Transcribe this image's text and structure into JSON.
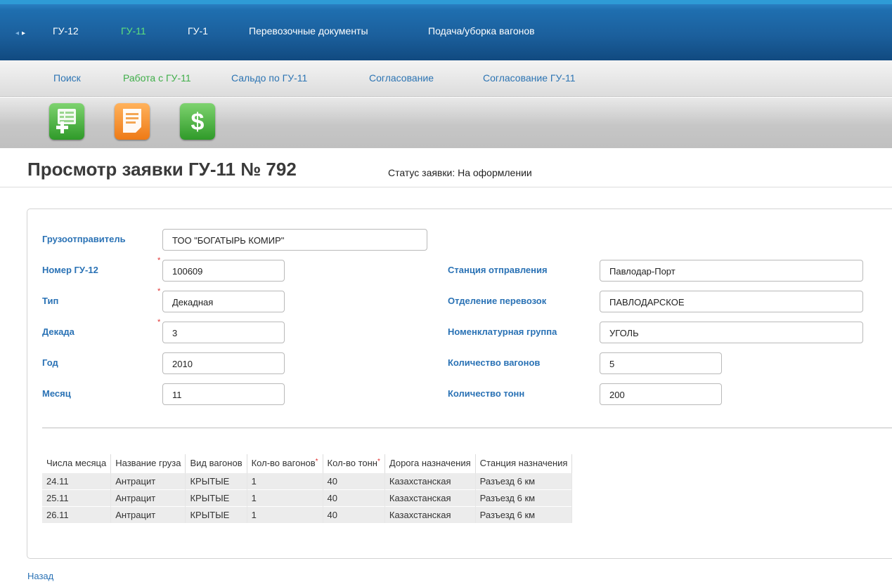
{
  "topnav": {
    "items": [
      {
        "label": "ГУ-12"
      },
      {
        "label": "ГУ-11"
      },
      {
        "label": "ГУ-1"
      },
      {
        "label": "Перевозочные документы"
      },
      {
        "label": "Подача/уборка вагонов"
      }
    ],
    "active_index": 1
  },
  "subnav": {
    "items": [
      {
        "label": "Поиск"
      },
      {
        "label": "Работа с ГУ-11"
      },
      {
        "label": "Сальдо по ГУ-11"
      },
      {
        "label": "Согласование"
      },
      {
        "label": "Согласование ГУ-11"
      }
    ],
    "active_index": 1
  },
  "toolbar": {
    "buttons": [
      {
        "icon": "add-document-icon",
        "color": "#3fa83a"
      },
      {
        "icon": "document-icon",
        "color": "#f08a22"
      },
      {
        "icon": "dollar-icon",
        "color": "#3fa83a"
      }
    ]
  },
  "page": {
    "title": "Просмотр заявки ГУ-11 №  792",
    "status": "Статус заявки: На оформлении"
  },
  "form": {
    "shipper": {
      "label": "Грузоотправитель",
      "value": "ТОО \"БОГАТЫРЬ КОМИР\""
    },
    "gu12_number": {
      "label": "Номер ГУ-12",
      "value": "100609",
      "required": true
    },
    "type": {
      "label": "Тип",
      "value": "Декадная",
      "required": true
    },
    "decade": {
      "label": "Декада",
      "value": "3",
      "required": true
    },
    "year": {
      "label": "Год",
      "value": "2010"
    },
    "month": {
      "label": "Месяц",
      "value": "11"
    },
    "departure_station": {
      "label": "Станция отправления",
      "value": "Павлодар-Порт"
    },
    "transport_division": {
      "label": "Отделение перевозок",
      "value": "ПАВЛОДАРСКОЕ"
    },
    "nomenclature_group": {
      "label": "Номенклатурная группа",
      "value": "УГОЛЬ"
    },
    "wagon_count": {
      "label": "Количество вагонов",
      "value": "5"
    },
    "tonnage": {
      "label": "Количество тонн",
      "value": "200"
    },
    "required_mark": "*"
  },
  "table": {
    "headers": [
      {
        "label": "Числа месяца",
        "required": false
      },
      {
        "label": "Название груза",
        "required": false
      },
      {
        "label": "Вид вагонов",
        "required": false
      },
      {
        "label": "Кол-во вагонов",
        "required": true
      },
      {
        "label": "Кол-во тонн",
        "required": true
      },
      {
        "label": "Дорога назначения",
        "required": false
      },
      {
        "label": "Станция назначения",
        "required": false
      }
    ],
    "rows": [
      [
        "24.11",
        "Антрацит",
        "КРЫТЫЕ",
        "1",
        "40",
        "Казахстанская",
        "Разъезд 6 км"
      ],
      [
        "25.11",
        "Антрацит",
        "КРЫТЫЕ",
        "1",
        "40",
        "Казахстанская",
        "Разъезд 6 км"
      ],
      [
        "26.11",
        "Антрацит",
        "КРЫТЫЕ",
        "1",
        "40",
        "Казахстанская",
        "Разъезд 6 км"
      ]
    ]
  },
  "footer": {
    "back_label": "Назад"
  }
}
